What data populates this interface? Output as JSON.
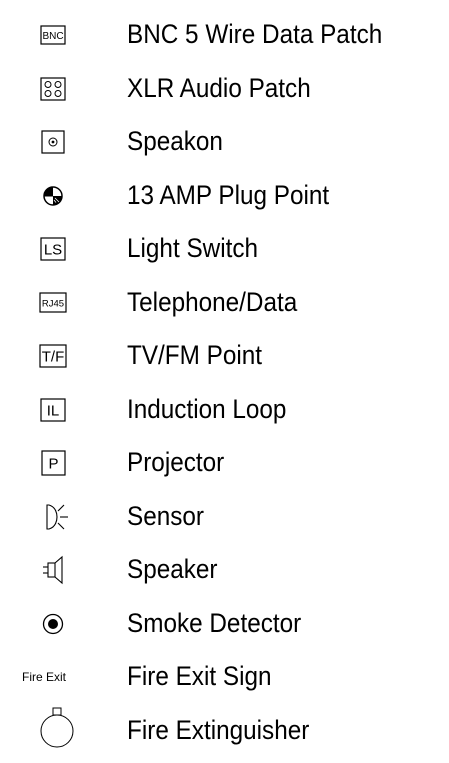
{
  "legend": {
    "items": [
      {
        "icon": "bnc-patch-icon",
        "symbol_text": "BNC",
        "label": "BNC 5 Wire Data Patch"
      },
      {
        "icon": "xlr-patch-icon",
        "symbol_text": "",
        "label": "XLR Audio Patch"
      },
      {
        "icon": "speakon-icon",
        "symbol_text": "",
        "label": "Speakon"
      },
      {
        "icon": "plug-point-icon",
        "symbol_text": "",
        "label": "13 AMP Plug Point"
      },
      {
        "icon": "light-switch-icon",
        "symbol_text": "LS",
        "label": "Light Switch"
      },
      {
        "icon": "telephone-data-icon",
        "symbol_text": "RJ45",
        "label": "Telephone/Data"
      },
      {
        "icon": "tv-fm-icon",
        "symbol_text": "T/F",
        "label": "TV/FM Point"
      },
      {
        "icon": "induction-loop-icon",
        "symbol_text": "IL",
        "label": "Induction Loop"
      },
      {
        "icon": "projector-icon",
        "symbol_text": "P",
        "label": "Projector"
      },
      {
        "icon": "sensor-icon",
        "symbol_text": "",
        "label": "Sensor"
      },
      {
        "icon": "speaker-icon",
        "symbol_text": "",
        "label": "Speaker"
      },
      {
        "icon": "smoke-detector-icon",
        "symbol_text": "",
        "label": "Smoke Detector"
      },
      {
        "icon": "fire-exit-sign-icon",
        "symbol_text": "Fire Exit",
        "label": "Fire Exit Sign"
      },
      {
        "icon": "fire-extinguisher-icon",
        "symbol_text": "",
        "label": "Fire Extinguisher"
      }
    ]
  }
}
